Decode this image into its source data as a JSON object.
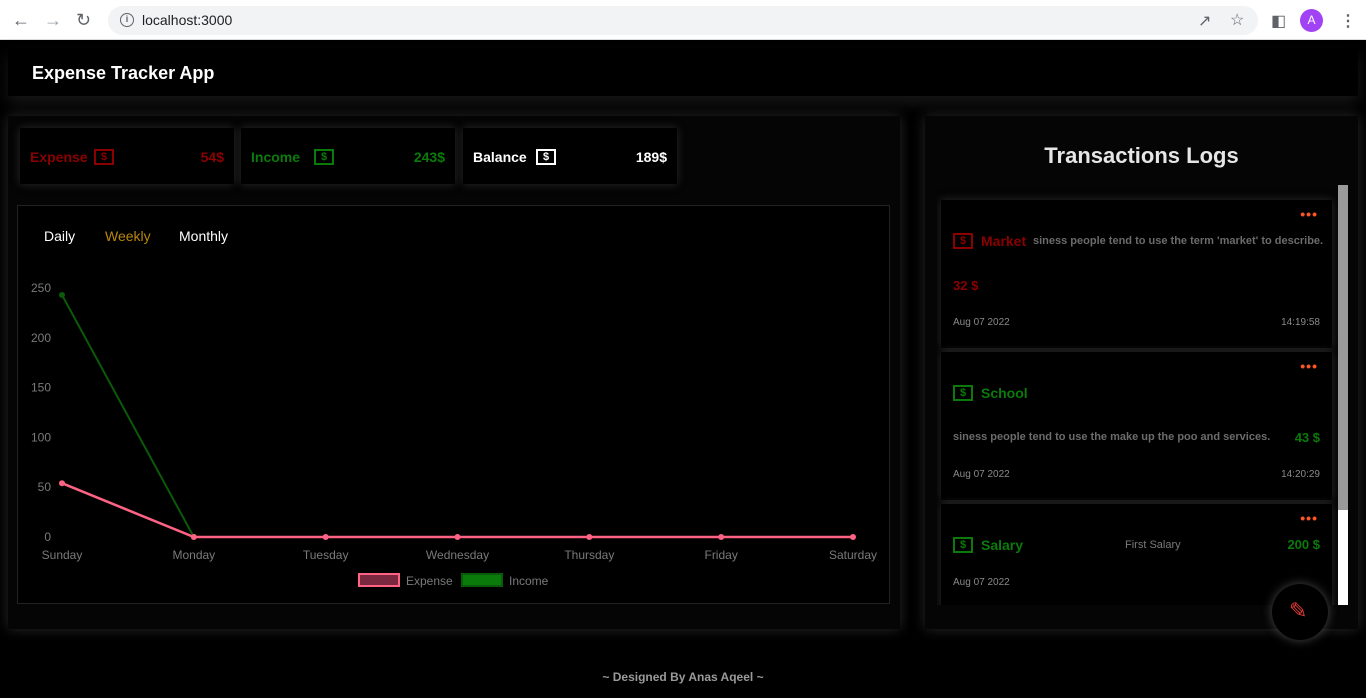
{
  "browser": {
    "url": "localhost:3000",
    "back_icon": "arrow-left-icon",
    "forward_icon": "arrow-right-icon",
    "reload_icon": "reload-icon",
    "share_icon": "share-icon",
    "star_icon": "star-icon",
    "sidebar_icon": "sidebar-icon",
    "profile_initial": "A",
    "menu_icon": "kebab-menu-icon"
  },
  "app": {
    "title": "Expense Tracker App"
  },
  "summary": {
    "expense": {
      "label": "Expense",
      "value": "54$",
      "color": "#8b0000"
    },
    "income": {
      "label": "Income",
      "value": "243$",
      "color": "#0a7a0a"
    },
    "balance": {
      "label": "Balance",
      "value": "189$",
      "color": "#ffffff"
    },
    "dollar_glyph": "$"
  },
  "tabs": [
    {
      "label": "Daily",
      "color": "#ffffff"
    },
    {
      "label": "Weekly",
      "color": "#b8860b"
    },
    {
      "label": "Monthly",
      "color": "#ffffff"
    }
  ],
  "chart_data": {
    "type": "line",
    "categories": [
      "Sunday",
      "Monday",
      "Tuesday",
      "Wednesday",
      "Thursday",
      "Friday",
      "Saturday"
    ],
    "series": [
      {
        "name": "Expense",
        "values": [
          54,
          0,
          0,
          0,
          0,
          0,
          0
        ],
        "color": "#ff6384"
      },
      {
        "name": "Income",
        "values": [
          243,
          0,
          null,
          null,
          null,
          null,
          null
        ],
        "color": "#0a5a0a"
      }
    ],
    "yticks": [
      0,
      50,
      100,
      150,
      200,
      250
    ],
    "ylim": [
      0,
      250
    ],
    "grid": false,
    "legend": "bottom"
  },
  "logs": {
    "title": "Transactions Logs",
    "menu_glyph": "•••",
    "items": [
      {
        "name": "Market",
        "type": "expense",
        "color": "#8b0000",
        "description": "siness people tend to use the term 'market' to describe.",
        "amount": "32 $",
        "date": "Aug 07 2022",
        "time": "14:19:58"
      },
      {
        "name": "School",
        "type": "income",
        "color": "#0a7a0a",
        "description": "siness people tend to use the make up the poo and services.",
        "amount": "43 $",
        "date": "Aug 07 2022",
        "time": "14:20:29"
      },
      {
        "name": "Salary",
        "type": "income",
        "color": "#0a7a0a",
        "description": "First Salary",
        "amount": "200 $",
        "date": "Aug 07 2022",
        "time": ""
      }
    ]
  },
  "fab": {
    "icon": "pencil-icon",
    "glyph": "✎"
  },
  "footer": {
    "text": "~ Designed By Anas Aqeel ~"
  }
}
